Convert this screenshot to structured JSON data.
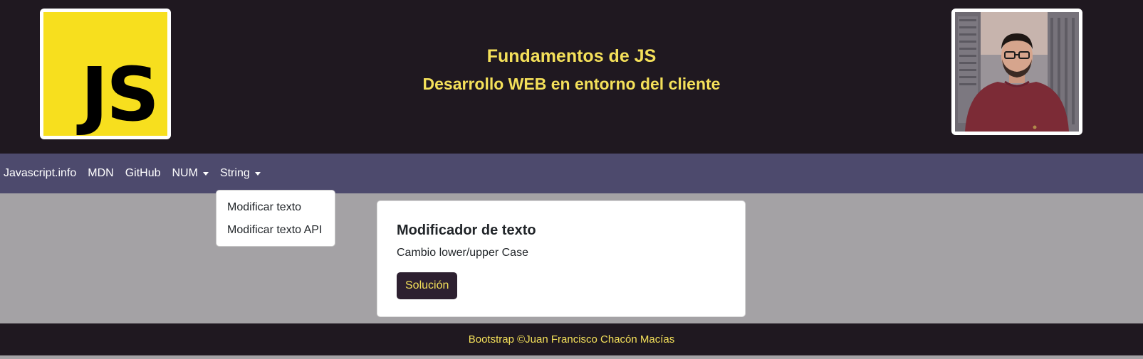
{
  "header": {
    "logo_text": "JS",
    "title": "Fundamentos de JS",
    "subtitle": "Desarrollo WEB en entorno del cliente"
  },
  "navbar": {
    "items": [
      {
        "label": "Javascript.info"
      },
      {
        "label": "MDN"
      },
      {
        "label": "GitHub"
      },
      {
        "label": "NUM"
      },
      {
        "label": "String"
      }
    ]
  },
  "dropdown": {
    "items": [
      {
        "label": "Modificar texto"
      },
      {
        "label": "Modificar texto API"
      }
    ]
  },
  "card": {
    "title": "Modificador de texto",
    "text": "Cambio lower/upper Case",
    "button_label": "Solución"
  },
  "footer": {
    "text": "Bootstrap ©Juan Francisco Chacón Macías"
  },
  "colors": {
    "header_bg": "#1f1820",
    "navbar_bg": "#4d4a6d",
    "accent_yellow": "#f4e05a",
    "js_yellow": "#f7df1e",
    "button_bg": "#2d2030",
    "page_bg": "#a4a2a5"
  },
  "icons": [
    "caret-down-icon"
  ]
}
